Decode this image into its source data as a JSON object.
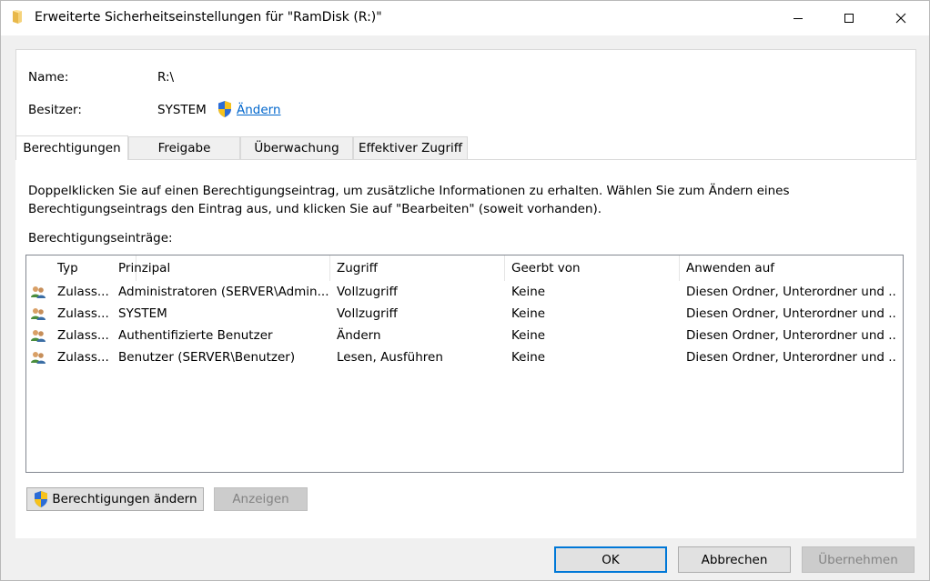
{
  "window": {
    "title": "Erweiterte Sicherheitseinstellungen für \"RamDisk (R:)\""
  },
  "info": {
    "name_label": "Name:",
    "name_value": "R:\\",
    "owner_label": "Besitzer:",
    "owner_value": "SYSTEM",
    "owner_change_link": "Ändern"
  },
  "tabs": [
    {
      "label": "Berechtigungen",
      "active": true
    },
    {
      "label": "Freigabe",
      "active": false
    },
    {
      "label": "Überwachung",
      "active": false
    },
    {
      "label": "Effektiver Zugriff",
      "active": false
    }
  ],
  "description": "Doppelklicken Sie auf einen Berechtigungseintrag, um zusätzliche Informationen zu erhalten. Wählen Sie zum Ändern eines Berechtigungseintrags den Eintrag aus, und klicken Sie auf \"Bearbeiten\" (soweit vorhanden).",
  "entries_label": "Berechtigungseinträge:",
  "table": {
    "columns": [
      "Typ",
      "Prinzipal",
      "Zugriff",
      "Geerbt von",
      "Anwenden auf"
    ],
    "rows": [
      [
        "Zulass...",
        "Administratoren (SERVER\\Admin...",
        "Vollzugriff",
        "Keine",
        "Diesen Ordner, Unterordner und ..."
      ],
      [
        "Zulass...",
        "SYSTEM",
        "Vollzugriff",
        "Keine",
        "Diesen Ordner, Unterordner und ..."
      ],
      [
        "Zulass...",
        "Authentifizierte Benutzer",
        "Ändern",
        "Keine",
        "Diesen Ordner, Unterordner und ..."
      ],
      [
        "Zulass...",
        "Benutzer (SERVER\\Benutzer)",
        "Lesen, Ausführen",
        "Keine",
        "Diesen Ordner, Unterordner und ..."
      ]
    ]
  },
  "buttons": {
    "change_permissions": "Berechtigungen ändern",
    "view": "Anzeigen",
    "ok": "OK",
    "cancel": "Abbrechen",
    "apply": "Übernehmen"
  },
  "colors": {
    "link": "#0066cc",
    "accent": "#0078d7"
  },
  "icons": {
    "folder": "folder-icon",
    "shield": "uac-shield-icon",
    "user": "users-icon"
  }
}
